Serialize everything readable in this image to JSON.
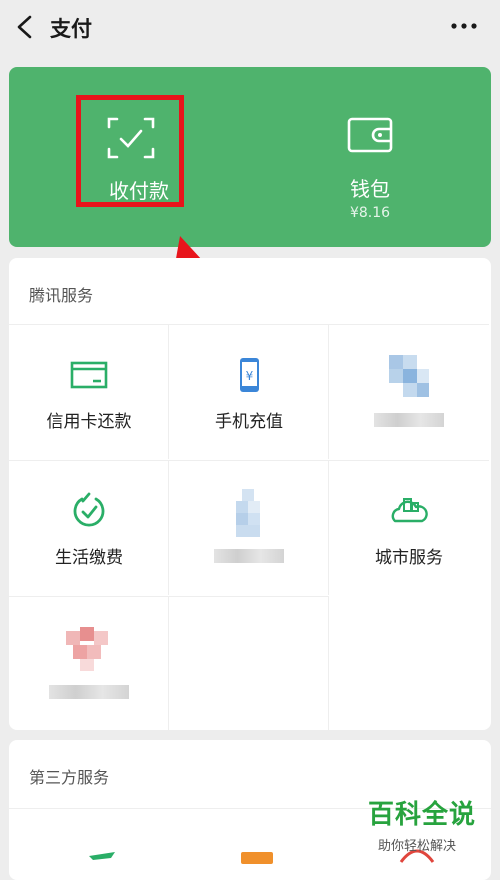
{
  "header": {
    "title": "支付",
    "back_icon": "chevron-left-icon",
    "more_icon": "ellipsis-icon"
  },
  "top_card": {
    "background_color": "#4fb36d",
    "pay": {
      "label": "收付款",
      "icon": "scan-check-icon"
    },
    "wallet": {
      "label": "钱包",
      "balance": "¥8.16",
      "icon": "wallet-icon"
    }
  },
  "annotation": {
    "highlight_color": "#e8141b",
    "arrow_color": "#e8141b"
  },
  "tencent_services": {
    "title": "腾讯服务",
    "items": [
      {
        "label": "信用卡还款",
        "icon": "credit-card-icon"
      },
      {
        "label": "手机充值",
        "icon": "mobile-recharge-icon"
      },
      {
        "label": "",
        "icon": "blurred-icon"
      },
      {
        "label": "生活缴费",
        "icon": "utility-bill-icon"
      },
      {
        "label": "",
        "icon": "blurred-icon"
      },
      {
        "label": "城市服务",
        "icon": "city-services-icon"
      },
      {
        "label": "",
        "icon": "blurred-icon"
      }
    ]
  },
  "third_party_services": {
    "title": "第三方服务"
  },
  "watermark": {
    "title": "百科全说",
    "subtitle": "助你轻松解决",
    "color": "#27a33e"
  }
}
